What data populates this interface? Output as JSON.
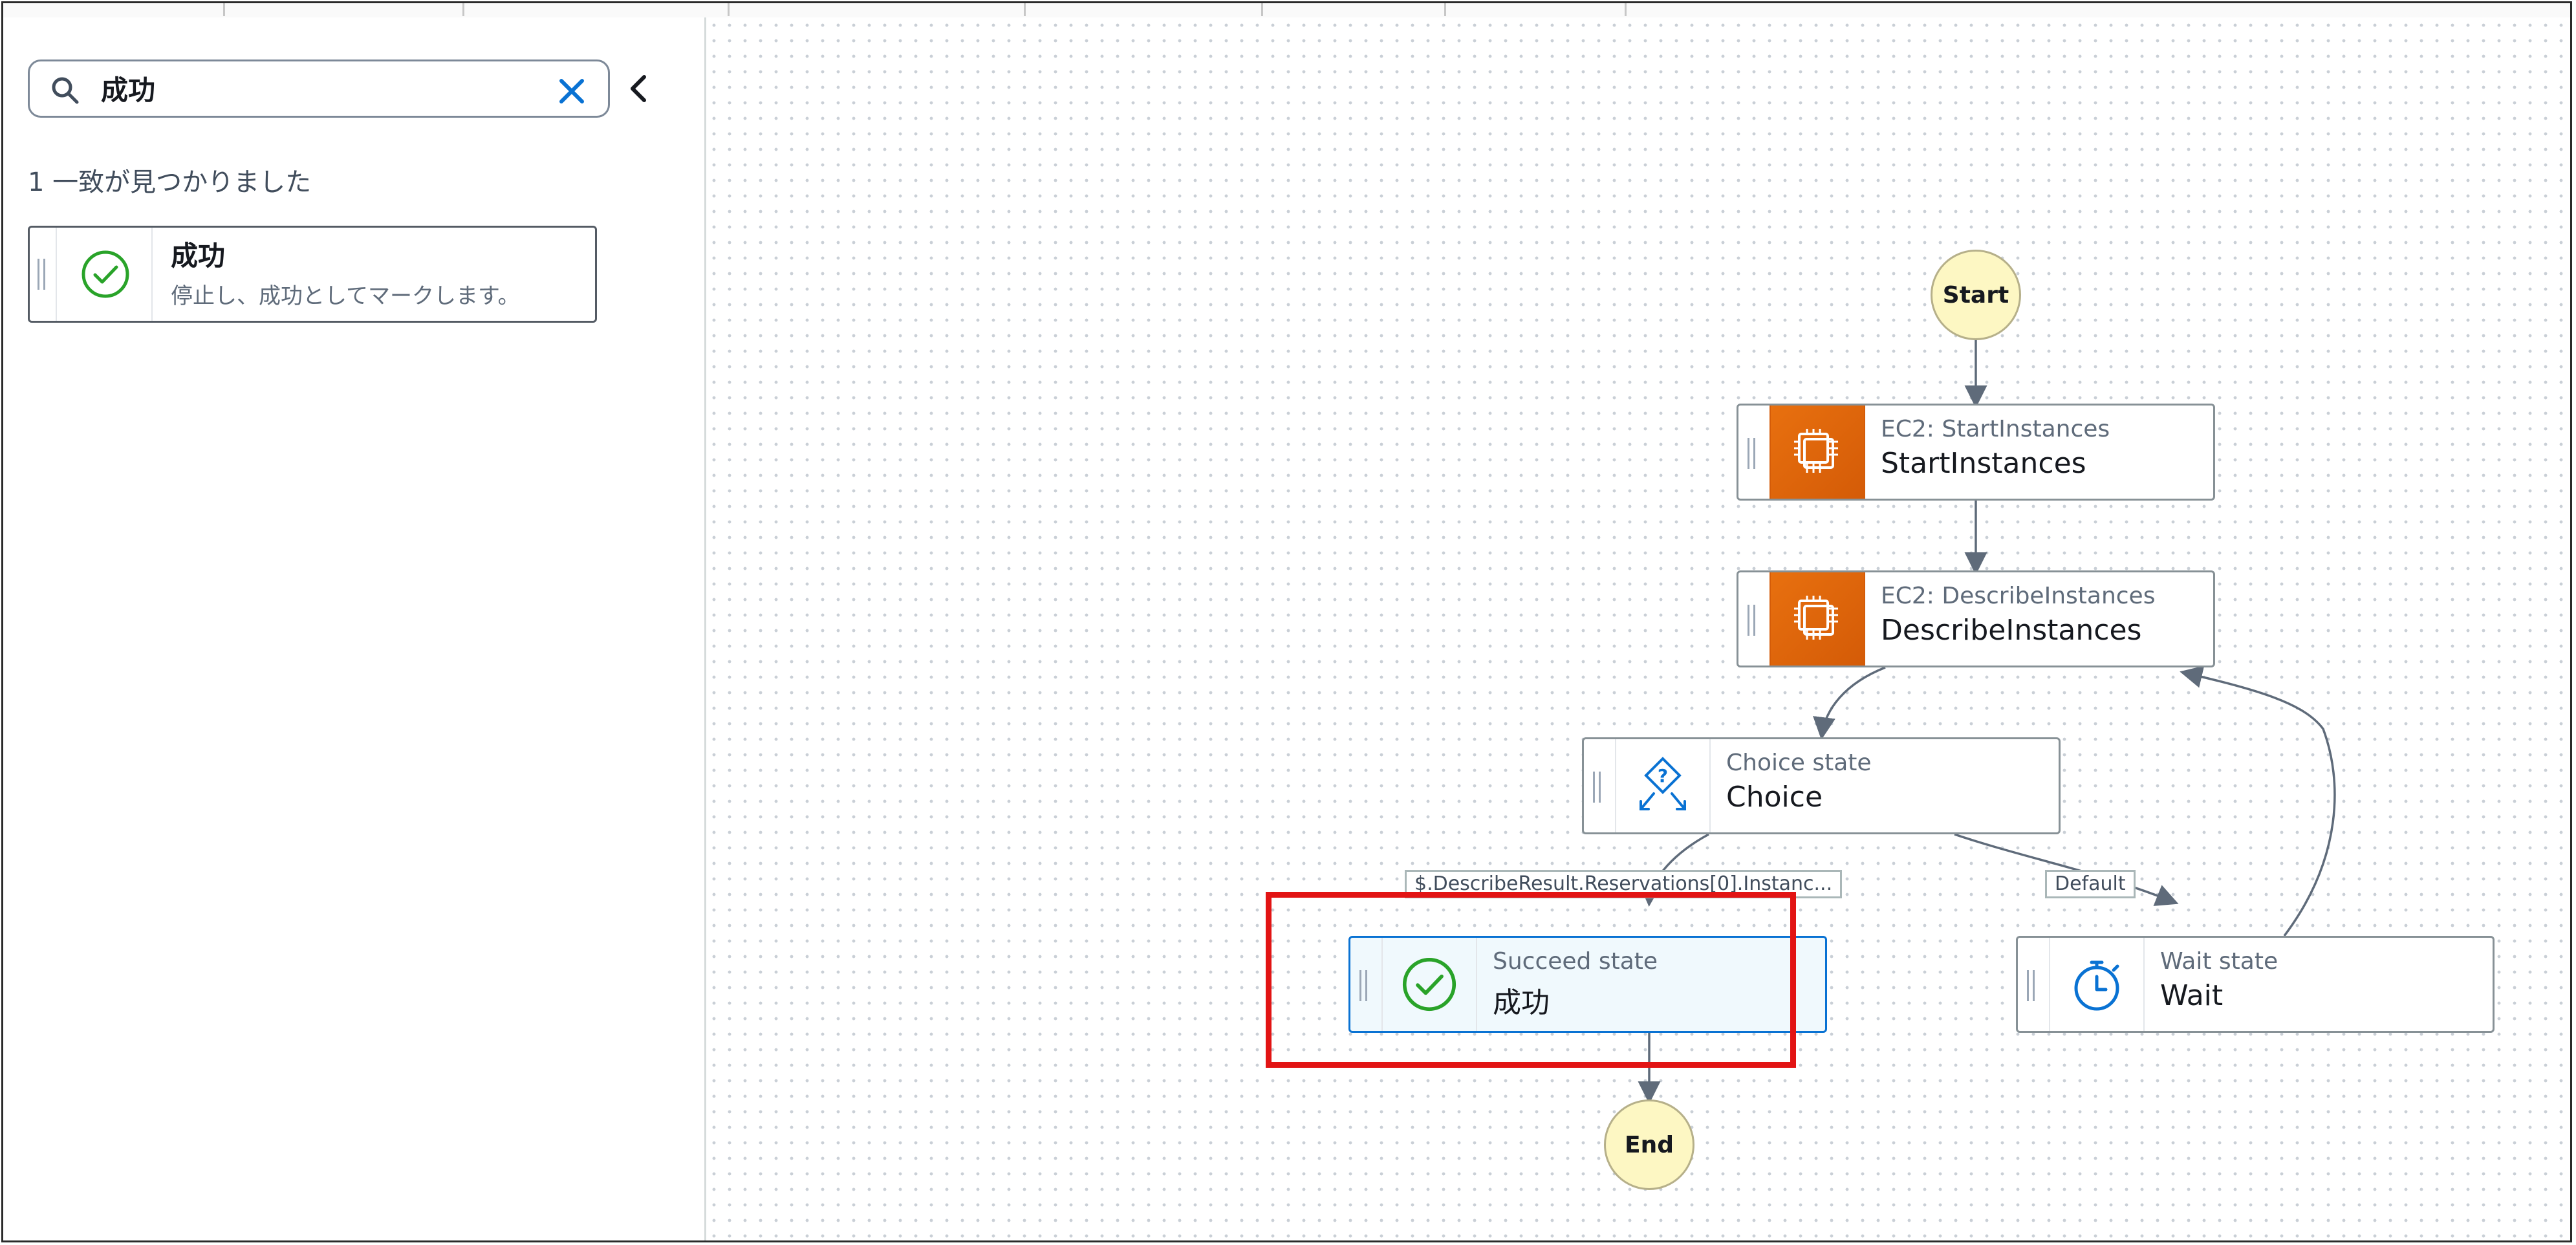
{
  "search": {
    "value": "成功",
    "match_count_text": "1 一致が見つかりました"
  },
  "search_result": {
    "title": "成功",
    "description": "停止し、成功としてマークします。"
  },
  "workflow": {
    "start_label": "Start",
    "end_label": "End",
    "nodes": {
      "start_instances": {
        "type": "EC2: StartInstances",
        "name": "StartInstances"
      },
      "describe_instances": {
        "type": "EC2: DescribeInstances",
        "name": "DescribeInstances"
      },
      "choice": {
        "type": "Choice state",
        "name": "Choice"
      },
      "succeed": {
        "type": "Succeed state",
        "name": "成功"
      },
      "wait": {
        "type": "Wait state",
        "name": "Wait"
      }
    },
    "edge_labels": {
      "choice_rule": "$.DescribeResult.Reservations[0].Instanc...",
      "default": "Default"
    }
  },
  "colors": {
    "accent_blue": "#0972d3",
    "success_green": "#29a329",
    "aws_orange": "#e8700f",
    "terminal_fill": "#fdf7c3",
    "highlight_red": "#e21414"
  }
}
